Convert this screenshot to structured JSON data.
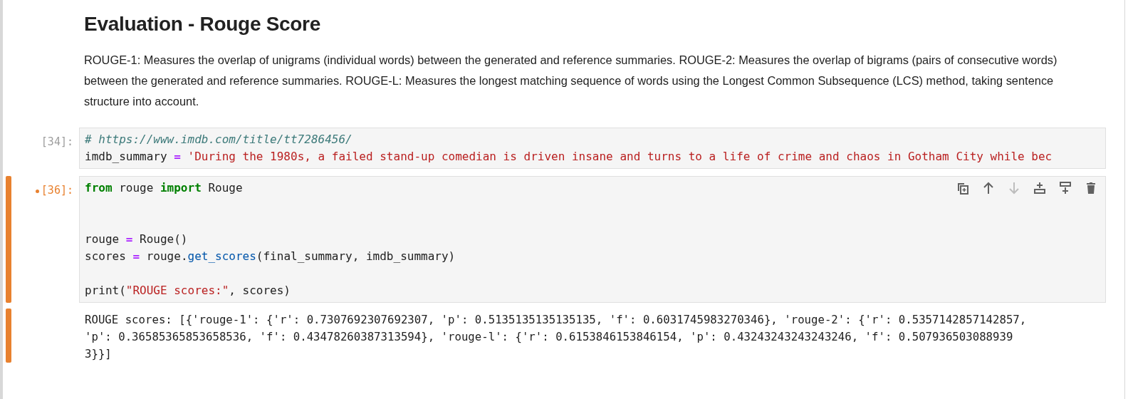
{
  "markdown": {
    "heading": "Evaluation - Rouge Score",
    "paragraph": "ROUGE-1: Measures the overlap of unigrams (individual words) between the generated and reference summaries. ROUGE-2: Measures the overlap of bigrams (pairs of consecutive words) between the generated and reference summaries. ROUGE-L: Measures the longest matching sequence of words using the Longest Common Subsequence (LCS) method, taking sentence structure into account."
  },
  "cells": [
    {
      "prompt": "[34]:",
      "selected": false,
      "modified": false,
      "code": [
        {
          "kind": "code",
          "tokens": [
            {
              "kind": "comment",
              "text": "# https://www.imdb.com/title/tt7286456/"
            }
          ]
        },
        {
          "kind": "code",
          "tokens": [
            {
              "kind": "name",
              "text": "imdb_summary "
            },
            {
              "kind": "op",
              "text": "="
            },
            {
              "kind": "string",
              "text": " 'During the 1980s, a failed stand-up comedian is driven insane and turns to a life of crime and chaos in Gotham City while bec"
            }
          ]
        }
      ]
    },
    {
      "prompt": "[36]:",
      "selected": true,
      "modified": true,
      "code": [
        {
          "kind": "code",
          "tokens": [
            {
              "kind": "keyword",
              "text": "from"
            },
            {
              "kind": "name",
              "text": " rouge "
            },
            {
              "kind": "keyword",
              "text": "import"
            },
            {
              "kind": "name",
              "text": " Rouge"
            }
          ]
        },
        {
          "kind": "blank"
        },
        {
          "kind": "blank"
        },
        {
          "kind": "code",
          "tokens": [
            {
              "kind": "name",
              "text": "rouge "
            },
            {
              "kind": "op",
              "text": "="
            },
            {
              "kind": "name",
              "text": " Rouge()"
            }
          ]
        },
        {
          "kind": "code",
          "tokens": [
            {
              "kind": "name",
              "text": "scores "
            },
            {
              "kind": "op",
              "text": "="
            },
            {
              "kind": "name",
              "text": " rouge."
            },
            {
              "kind": "func",
              "text": "get_scores"
            },
            {
              "kind": "name",
              "text": "(final_summary, imdb_summary)"
            }
          ]
        },
        {
          "kind": "blank"
        },
        {
          "kind": "code",
          "tokens": [
            {
              "kind": "name",
              "text": "print("
            },
            {
              "kind": "string",
              "text": "\"ROUGE scores:\""
            },
            {
              "kind": "name",
              "text": ", scores)"
            }
          ]
        }
      ],
      "toolbar": [
        {
          "kind": "duplicate",
          "disabled": false
        },
        {
          "kind": "move-up",
          "disabled": false
        },
        {
          "kind": "move-down",
          "disabled": true
        },
        {
          "kind": "insert-above",
          "disabled": false
        },
        {
          "kind": "insert-below",
          "disabled": false
        },
        {
          "kind": "delete",
          "disabled": false
        }
      ],
      "output": [
        "ROUGE scores: [{'rouge-1': {'r': 0.7307692307692307, 'p': 0.5135135135135135, 'f': 0.6031745983270346}, 'rouge-2': {'r': 0.5357142857142857,",
        "'p': 0.36585365853658536, 'f': 0.43478260387313594}, 'rouge-l': {'r': 0.6153846153846154, 'p': 0.43243243243243246, 'f': 0.507936503088939",
        "3}}]"
      ]
    }
  ]
}
